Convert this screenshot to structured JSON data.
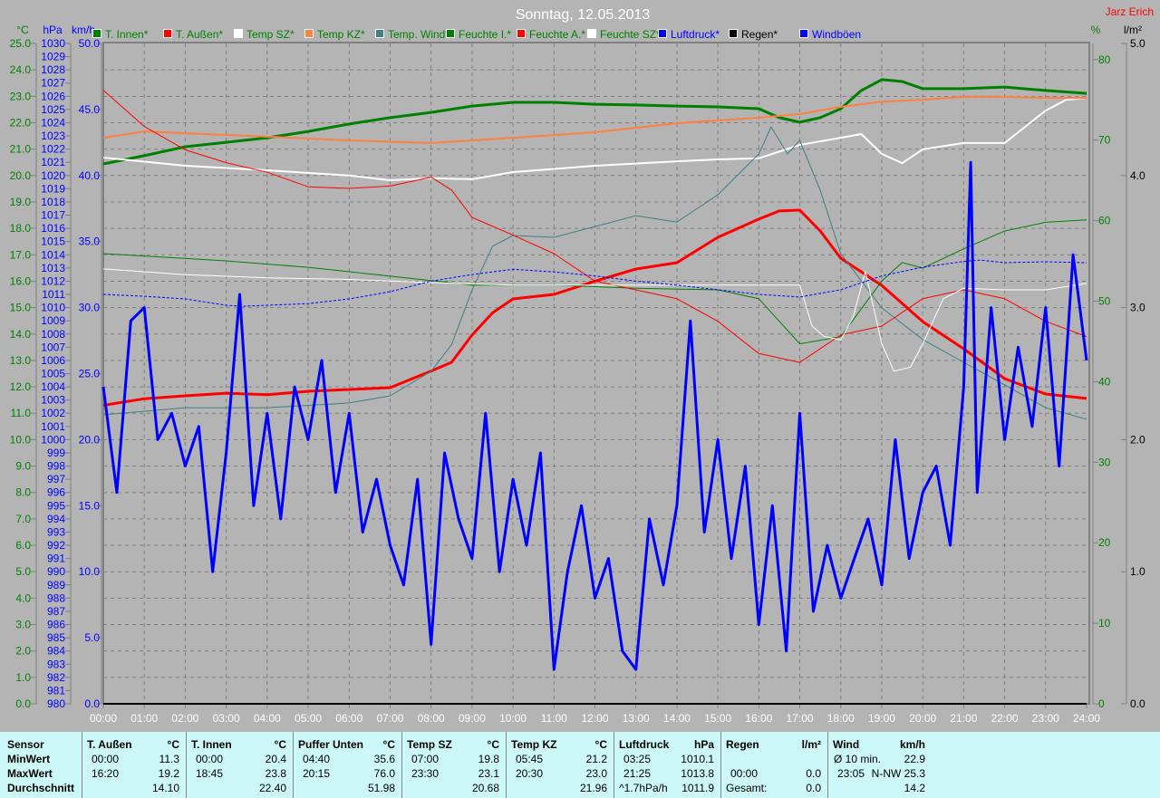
{
  "title": "Sonntag, 12.05.2013",
  "author": "Jarz Erich",
  "colors": {
    "bg": "#b4b4b4",
    "green": "#008000",
    "blue": "#0000ff",
    "red": "#ff0000",
    "white": "#ffffff",
    "orange": "#ff8040",
    "teal": "#408080",
    "grid": "#808080"
  },
  "chart_data": {
    "type": "line",
    "title": "Sonntag, 12.05.2013",
    "xlabel": "",
    "x_ticks": [
      "00:00",
      "01:00",
      "02:00",
      "03:00",
      "04:00",
      "05:00",
      "06:00",
      "07:00",
      "08:00",
      "09:00",
      "10:00",
      "11:00",
      "12:00",
      "13:00",
      "14:00",
      "15:00",
      "16:00",
      "17:00",
      "18:00",
      "19:00",
      "20:00",
      "21:00",
      "22:00",
      "23:00",
      "24:00"
    ],
    "xlim": [
      0,
      24
    ],
    "grid": true,
    "legend_position": "top",
    "axes": {
      "temp": {
        "unit": "°C",
        "range": [
          0,
          25
        ],
        "step": 1,
        "decimals": 1,
        "color": "#008000"
      },
      "pressure": {
        "unit": "hPa",
        "range": [
          980,
          1030
        ],
        "step": 1,
        "decimals": 0,
        "color": "#0000ff"
      },
      "wind": {
        "unit": "km/h",
        "range": [
          0,
          50
        ],
        "step": 5,
        "decimals": 1,
        "color": "#0000ff"
      },
      "humidity": {
        "unit": "%",
        "range": [
          0,
          82
        ],
        "ticks": [
          0,
          10,
          20,
          30,
          40,
          50,
          60,
          70,
          80
        ],
        "decimals": 0,
        "color": "#008000"
      },
      "rain": {
        "unit": "l/m²",
        "range": [
          0,
          5
        ],
        "step": 1,
        "decimals": 1,
        "color": "#000000"
      }
    },
    "series": [
      {
        "name": "T. Innen*",
        "axis": "temp",
        "color": "#008000",
        "width": 3,
        "x": [
          0,
          1,
          2,
          3,
          4,
          5,
          6,
          7,
          8,
          9,
          10,
          11,
          12,
          13,
          14,
          15,
          16,
          16.5,
          17,
          17.5,
          18,
          18.5,
          19,
          19.5,
          20,
          21,
          22,
          23,
          24
        ],
        "y": [
          20.44,
          20.75,
          21.09,
          21.26,
          21.43,
          21.67,
          21.95,
          22.19,
          22.39,
          22.63,
          22.77,
          22.77,
          22.7,
          22.67,
          22.63,
          22.6,
          22.53,
          22.19,
          22.02,
          22.19,
          22.53,
          23.22,
          23.63,
          23.56,
          23.29,
          23.29,
          23.35,
          23.22,
          23.11
        ]
      },
      {
        "name": "T. Außen*",
        "axis": "temp",
        "color": "#ff0000",
        "width": 3,
        "x": [
          0,
          1,
          2,
          3,
          4,
          5,
          6,
          7,
          8,
          8.5,
          9,
          9.5,
          10,
          11,
          12,
          13,
          14,
          15,
          16,
          16.5,
          17,
          17.5,
          18,
          19,
          20,
          21,
          22,
          23,
          24
        ],
        "y": [
          11.3,
          11.55,
          11.66,
          11.76,
          11.7,
          11.83,
          11.9,
          11.97,
          12.6,
          12.93,
          13.96,
          14.8,
          15.33,
          15.5,
          16.0,
          16.46,
          16.7,
          17.66,
          18.35,
          18.66,
          18.69,
          17.9,
          16.87,
          15.84,
          14.47,
          13.44,
          12.31,
          11.73,
          11.56
        ]
      },
      {
        "name": "Temp SZ*",
        "axis": "temp",
        "color": "#ffffff",
        "width": 2,
        "x": [
          0,
          2,
          4,
          6,
          7,
          8,
          9,
          10,
          12,
          14,
          15,
          16,
          17,
          18,
          18.5,
          19,
          19.5,
          20,
          21,
          22,
          23,
          23.5,
          24
        ],
        "y": [
          20.68,
          20.37,
          20.2,
          20.0,
          19.82,
          19.9,
          19.86,
          20.13,
          20.37,
          20.54,
          20.61,
          20.65,
          21.16,
          21.43,
          21.57,
          20.82,
          20.47,
          20.99,
          21.23,
          21.23,
          22.46,
          22.87,
          22.94
        ]
      },
      {
        "name": "Temp KZ*",
        "axis": "temp",
        "color": "#ff8040",
        "width": 2,
        "x": [
          0,
          1,
          2,
          4,
          6,
          8,
          10,
          12,
          14,
          16,
          17,
          18,
          19,
          20,
          21,
          22,
          23,
          24
        ],
        "y": [
          21.43,
          21.67,
          21.6,
          21.47,
          21.33,
          21.23,
          21.43,
          21.64,
          21.98,
          22.19,
          22.33,
          22.6,
          22.8,
          22.87,
          22.98,
          22.98,
          22.94,
          22.94
        ]
      },
      {
        "name": "Temp. Wind*",
        "axis": "temp",
        "color": "#408080",
        "width": 1,
        "x": [
          0,
          2,
          4,
          6,
          7,
          8,
          8.5,
          9,
          9.5,
          10,
          11,
          12,
          13,
          14,
          15,
          16,
          16.3,
          16.7,
          17,
          17.5,
          18,
          19,
          20,
          21,
          22,
          23,
          24
        ],
        "y": [
          10.94,
          11.21,
          11.21,
          11.39,
          11.66,
          12.59,
          13.6,
          15.67,
          17.32,
          17.73,
          17.66,
          18.07,
          18.48,
          18.24,
          19.27,
          20.82,
          21.84,
          20.82,
          21.33,
          19.44,
          17.04,
          14.99,
          13.79,
          12.93,
          12.07,
          11.21,
          10.77
        ]
      },
      {
        "name": "Feuchte I.*",
        "axis": "humidity",
        "color": "#008000",
        "width": 1,
        "x": [
          0,
          3,
          5,
          7,
          9,
          11,
          13,
          15,
          16,
          17,
          18,
          19,
          19.5,
          20,
          21,
          22,
          23,
          24
        ],
        "y": [
          55.9,
          55.0,
          54.2,
          53.1,
          52.0,
          52.0,
          51.6,
          51.4,
          50.3,
          44.7,
          45.6,
          52.5,
          54.8,
          54.1,
          56.5,
          58.7,
          59.8,
          60.1
        ]
      },
      {
        "name": "Feuchte A.*",
        "axis": "humidity",
        "color": "#ff0000",
        "width": 1,
        "x": [
          0,
          1,
          2,
          3,
          4,
          5,
          6,
          7,
          8,
          8.5,
          9,
          10,
          11,
          12,
          13,
          14,
          15,
          16,
          17,
          17.5,
          18,
          19,
          20,
          21,
          22,
          23,
          24
        ],
        "y": [
          76.2,
          71.7,
          68.8,
          67.2,
          66.0,
          64.2,
          64.0,
          64.3,
          65.4,
          63.8,
          60.4,
          58.2,
          55.9,
          52.5,
          51.4,
          50.3,
          47.5,
          43.5,
          42.4,
          44.1,
          45.8,
          46.9,
          50.3,
          51.4,
          50.3,
          47.5,
          45.6
        ]
      },
      {
        "name": "Feuchte SZ*",
        "axis": "humidity",
        "color": "#ffffff",
        "width": 1,
        "x": [
          0,
          2,
          4,
          6,
          8,
          10,
          12,
          14,
          16,
          17,
          17.3,
          17.6,
          18,
          18.3,
          18.6,
          19,
          19.3,
          19.7,
          20,
          20.5,
          21,
          22,
          23,
          24
        ],
        "y": [
          54.0,
          53.3,
          52.9,
          52.7,
          52.3,
          52.0,
          52.0,
          52.0,
          52.0,
          52.0,
          46.9,
          45.6,
          45.2,
          48.0,
          53.7,
          44.7,
          41.3,
          41.8,
          44.7,
          50.3,
          51.6,
          51.4,
          51.4,
          52.2
        ]
      },
      {
        "name": "Luftdruck*",
        "axis": "pressure",
        "color": "#0000ff",
        "width": 1,
        "dashed": true,
        "x": [
          0,
          1,
          2,
          3,
          3.4,
          5,
          6,
          7,
          8,
          9,
          10,
          11,
          12,
          13,
          14,
          15,
          16,
          17,
          18,
          19,
          20,
          21,
          21.4,
          22,
          23,
          24
        ],
        "y": [
          1011.0,
          1010.86,
          1010.66,
          1010.18,
          1010.1,
          1010.3,
          1010.66,
          1011.2,
          1012.0,
          1012.5,
          1012.9,
          1012.7,
          1012.4,
          1012.0,
          1011.7,
          1011.35,
          1011.0,
          1010.8,
          1011.35,
          1012.4,
          1013.06,
          1013.5,
          1013.6,
          1013.4,
          1013.47,
          1013.4
        ]
      },
      {
        "name": "Regen*",
        "axis": "rain",
        "color": "#000000",
        "width": 2,
        "x": [
          0,
          24
        ],
        "y": [
          0,
          0
        ]
      },
      {
        "name": "Windböen",
        "axis": "wind",
        "color": "#0000ff",
        "width": 3,
        "x": [
          0,
          0.33,
          0.67,
          1,
          1.33,
          1.67,
          2,
          2.33,
          2.67,
          3,
          3.33,
          3.67,
          4,
          4.33,
          4.67,
          5,
          5.33,
          5.67,
          6,
          6.33,
          6.67,
          7,
          7.33,
          7.67,
          8,
          8.33,
          8.67,
          9,
          9.33,
          9.67,
          10,
          10.33,
          10.67,
          11,
          11.33,
          11.67,
          12,
          12.33,
          12.67,
          13,
          13.33,
          13.67,
          14,
          14.33,
          14.67,
          15,
          15.33,
          15.67,
          16,
          16.33,
          16.67,
          17,
          17.33,
          17.67,
          18,
          18.33,
          18.67,
          19,
          19.33,
          19.67,
          20,
          20.33,
          20.67,
          21,
          21.17,
          21.33,
          21.67,
          22,
          22.33,
          22.67,
          23,
          23.33,
          23.67,
          24
        ],
        "y": [
          24,
          16,
          29,
          30,
          20,
          22,
          18,
          21,
          10,
          19,
          31,
          15,
          22,
          14,
          24,
          20,
          26,
          16,
          22,
          13,
          17,
          12,
          9,
          17,
          4.5,
          19,
          14,
          11,
          22,
          10,
          17,
          12,
          19,
          2.6,
          10,
          15,
          8,
          11,
          4,
          2.6,
          14,
          9,
          15,
          29,
          13,
          20,
          11,
          18,
          6,
          15,
          4,
          22,
          7,
          12,
          8,
          11,
          14,
          9,
          20,
          11,
          16,
          18,
          12,
          24,
          41,
          16,
          30,
          20,
          27,
          21,
          30,
          18,
          34,
          26
        ]
      }
    ]
  },
  "table": {
    "row_labels": [
      "Sensor",
      "MinWert",
      "MaxWert",
      "Durchschnitt"
    ],
    "columns": [
      {
        "name": "T. Außen",
        "unit": "°C",
        "min_time": "00:00",
        "min": "11.3",
        "max_time": "16:20",
        "max": "19.2",
        "avg_label": "",
        "avg": "14.10"
      },
      {
        "name": "T. Innen",
        "unit": "°C",
        "min_time": "00:00",
        "min": "20.4",
        "max_time": "18:45",
        "max": "23.8",
        "avg_label": "",
        "avg": "22.40"
      },
      {
        "name": "Puffer Unten",
        "unit": "°C",
        "min_time": "04:40",
        "min": "35.6",
        "max_time": "20:15",
        "max": "76.0",
        "avg_label": "",
        "avg": "51.98"
      },
      {
        "name": "Temp SZ",
        "unit": "°C",
        "min_time": "07:00",
        "min": "19.8",
        "max_time": "23:30",
        "max": "23.1",
        "avg_label": "",
        "avg": "20.68"
      },
      {
        "name": "Temp KZ",
        "unit": "°C",
        "min_time": "05:45",
        "min": "21.2",
        "max_time": "20:30",
        "max": "23.0",
        "avg_label": "",
        "avg": "21.96"
      },
      {
        "name": "Luftdruck",
        "unit": "hPa",
        "min_time": "03:25",
        "min": "1010.1",
        "max_time": "21:25",
        "max": "1013.8",
        "avg_label": "^1.7hPa/h",
        "avg": "1011.9"
      },
      {
        "name": "Regen",
        "unit": "l/m²",
        "min_time": "",
        "min": "",
        "max_time": "00:00",
        "max": "0.0",
        "avg_label": "Gesamt:",
        "avg": "0.0"
      },
      {
        "name": "Wind",
        "unit": "km/h",
        "min_time": "Ø 10 min.",
        "min": "22.9",
        "max_time": "23:05",
        "max": "N-NW 25.3",
        "avg_label": "",
        "avg": "14.2"
      }
    ]
  }
}
